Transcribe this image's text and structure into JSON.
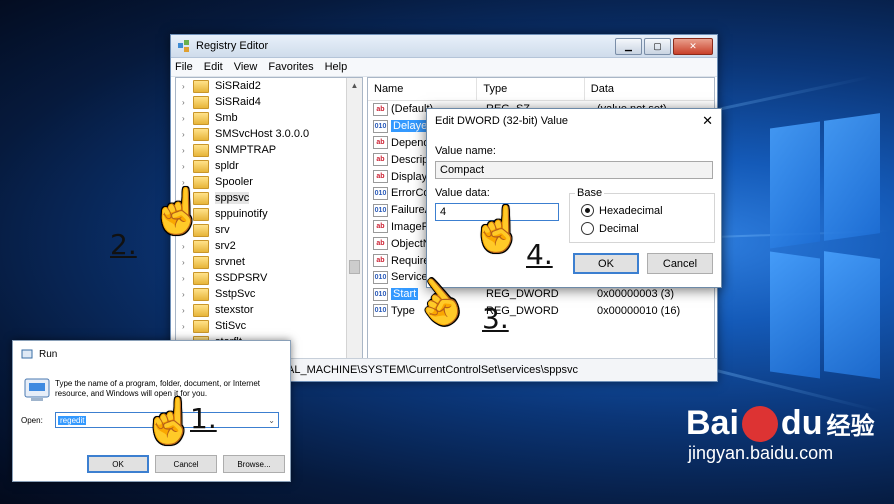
{
  "colors": {
    "desktop": "#0b3678",
    "selection": "#3399ff",
    "accent": "#3c7fd0"
  },
  "regedit": {
    "title": "Registry Editor",
    "menu": [
      "File",
      "Edit",
      "View",
      "Favorites",
      "Help"
    ],
    "tree": [
      "SiSRaid2",
      "SiSRaid4",
      "Smb",
      "SMSvcHost 3.0.0.0",
      "SNMPTRAP",
      "spldr",
      "Spooler",
      "sppsvc",
      "sppuinotify",
      "srv",
      "srv2",
      "srvnet",
      "SSDPSRV",
      "SstpSvc",
      "stexstor",
      "StiSvc",
      "storflt"
    ],
    "selected_tree": "sppsvc",
    "columns": {
      "name": "Name",
      "type": "Type",
      "data": "Data"
    },
    "rows": [
      {
        "name": "(Default)",
        "type": "REG_SZ",
        "data": "(value not set)",
        "icon": "ab"
      },
      {
        "name": "Delayed",
        "type": "",
        "data": "",
        "icon": "bin"
      },
      {
        "name": "Depend",
        "type": "",
        "data": "",
        "icon": "ab"
      },
      {
        "name": "Descript",
        "type": "",
        "data": "",
        "icon": "ab"
      },
      {
        "name": "DisplayN",
        "type": "",
        "data": "",
        "icon": "ab"
      },
      {
        "name": "ErrorCo",
        "type": "",
        "data": "",
        "icon": "bin"
      },
      {
        "name": "FailureA",
        "type": "",
        "data": "",
        "icon": "bin"
      },
      {
        "name": "ImageP",
        "type": "",
        "data": "",
        "icon": "ab"
      },
      {
        "name": "ObjectN",
        "type": "",
        "data": "",
        "icon": "ab"
      },
      {
        "name": "Require",
        "type": "",
        "data": "",
        "icon": "ab"
      },
      {
        "name": "ServiceS",
        "type": "",
        "data": "",
        "icon": "bin"
      },
      {
        "name": "Start",
        "type": "REG_DWORD",
        "data": "0x00000003 (3)",
        "icon": "bin"
      },
      {
        "name": "Type",
        "type": "REG_DWORD",
        "data": "0x00000010 (16)",
        "icon": "bin"
      }
    ],
    "status": "Computer\\HKEY_LOCAL_MACHINE\\SYSTEM\\CurrentControlSet\\services\\sppsvc"
  },
  "dword": {
    "title": "Edit DWORD (32-bit) Value",
    "close": "✕",
    "value_name_label": "Value name:",
    "value_name": "Compact",
    "value_data_label": "Value data:",
    "value_data": "4",
    "base_label": "Base",
    "hex": "Hexadecimal",
    "dec": "Decimal",
    "ok": "OK",
    "cancel": "Cancel"
  },
  "run": {
    "title": "Run",
    "desc": "Type the name of a program, folder, document, or Internet resource, and Windows will open it for you.",
    "open_label": "Open:",
    "open_value": "regedit",
    "ok": "OK",
    "cancel": "Cancel",
    "browse": "Browse..."
  },
  "steps": {
    "s1": "1.",
    "s2": "2.",
    "s3": "3.",
    "s4": "4."
  },
  "watermark": {
    "brand_a": "Bai",
    "brand_b": "du",
    "cn": "经验",
    "url": "jingyan.baidu.com"
  }
}
